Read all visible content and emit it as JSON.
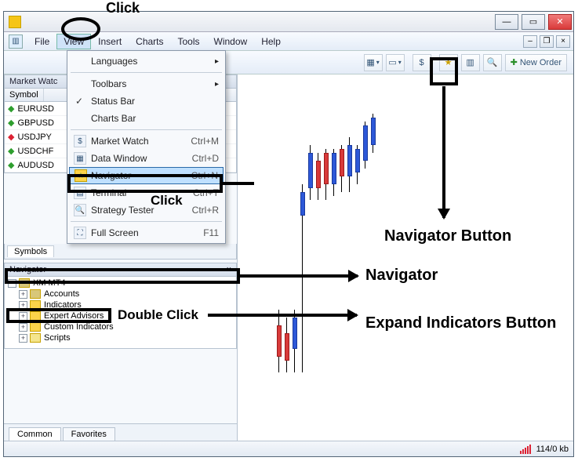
{
  "menubar": {
    "items": [
      "File",
      "View",
      "Insert",
      "Charts",
      "Tools",
      "Window",
      "Help"
    ]
  },
  "view_menu": {
    "languages": "Languages",
    "toolbars": "Toolbars",
    "statusbar": "Status Bar",
    "chartsbar": "Charts Bar",
    "market_watch": {
      "label": "Market Watch",
      "shortcut": "Ctrl+M"
    },
    "data_window": {
      "label": "Data Window",
      "shortcut": "Ctrl+D"
    },
    "navigator": {
      "label": "Navigator",
      "shortcut": "Ctrl+N"
    },
    "terminal": {
      "label": "Terminal",
      "shortcut": "Ctrl+T"
    },
    "strategy_tester": {
      "label": "Strategy Tester",
      "shortcut": "Ctrl+R"
    },
    "full_screen": {
      "label": "Full Screen",
      "shortcut": "F11"
    }
  },
  "toolbar": {
    "new_order": "New Order"
  },
  "market_watch": {
    "title": "Market Watc",
    "col_symbol": "Symbol",
    "rows": [
      {
        "dir": "up",
        "symbol": "EURUSD"
      },
      {
        "dir": "up",
        "symbol": "GBPUSD"
      },
      {
        "dir": "dn",
        "symbol": "USDJPY"
      },
      {
        "dir": "up",
        "symbol": "USDCHF"
      },
      {
        "dir": "up",
        "symbol": "AUDUSD"
      }
    ],
    "tab_symbols": "Symbols"
  },
  "navigator": {
    "title": "Navigator",
    "root": "XM MT4",
    "items": [
      "Accounts",
      "Indicators",
      "Expert Advisors",
      "Custom Indicators",
      "Scripts"
    ]
  },
  "bottom_tabs": {
    "common": "Common",
    "favorites": "Favorites"
  },
  "status": {
    "conn": "114/0 kb"
  },
  "annotations": {
    "click1": "Click",
    "click2": "Click",
    "double_click": "Double Click",
    "nav_button": "Navigator Button",
    "navigator": "Navigator",
    "expand": "Expand Indicators Button"
  }
}
